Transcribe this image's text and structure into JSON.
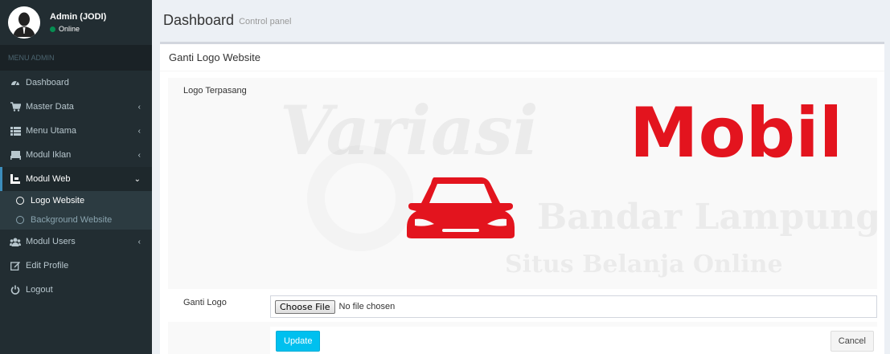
{
  "user": {
    "name": "Admin (JODI)",
    "status": "Online"
  },
  "sidebar": {
    "header": "MENU ADMIN",
    "items": [
      {
        "label": "Dashboard",
        "icon": "dashboard-icon"
      },
      {
        "label": "Master Data",
        "icon": "cart-icon"
      },
      {
        "label": "Menu Utama",
        "icon": "list-icon"
      },
      {
        "label": "Modul Iklan",
        "icon": "bed-icon"
      },
      {
        "label": "Modul Web",
        "icon": "web-icon"
      },
      {
        "label": "Modul Users",
        "icon": "users-icon"
      },
      {
        "label": "Edit Profile",
        "icon": "edit-icon"
      },
      {
        "label": "Logout",
        "icon": "power-icon"
      }
    ],
    "submenu": [
      {
        "label": "Logo Website"
      },
      {
        "label": "Background Website"
      }
    ]
  },
  "header": {
    "title": "Dashboard",
    "subtitle": "Control panel"
  },
  "box": {
    "title": "Ganti Logo Website",
    "logo_label": "Logo Terpasang",
    "file_label": "Ganti Logo",
    "choose_button": "Choose File",
    "file_status": "No file chosen",
    "update_button": "Update",
    "cancel_button": "Cancel"
  },
  "logo": {
    "word1": "Variasi",
    "word2": "Mobil",
    "line2": "Bandar Lampung",
    "line3": "Situs Belanja Online",
    "brand_color": "#e3141e"
  },
  "colors": {
    "sidebar_bg": "#222d32",
    "accent": "#3c8dbc",
    "info": "#00c0ef"
  }
}
